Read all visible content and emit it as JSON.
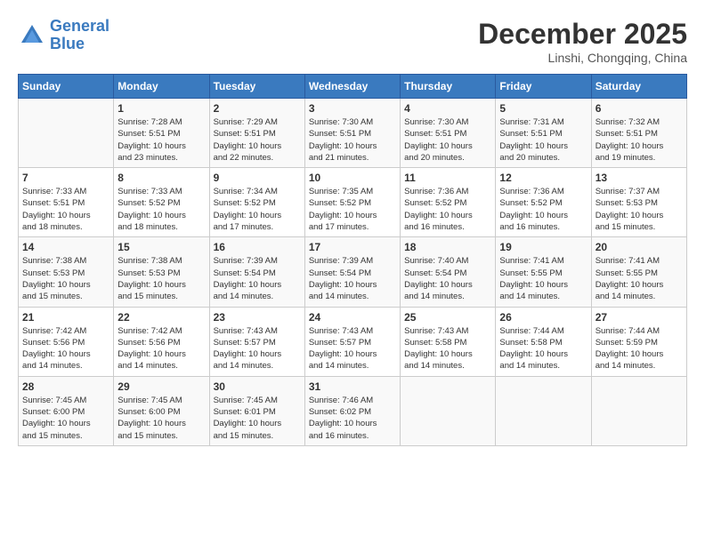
{
  "header": {
    "logo_line1": "General",
    "logo_line2": "Blue",
    "month": "December 2025",
    "location": "Linshi, Chongqing, China"
  },
  "weekdays": [
    "Sunday",
    "Monday",
    "Tuesday",
    "Wednesday",
    "Thursday",
    "Friday",
    "Saturday"
  ],
  "weeks": [
    [
      {
        "day": "",
        "info": ""
      },
      {
        "day": "1",
        "info": "Sunrise: 7:28 AM\nSunset: 5:51 PM\nDaylight: 10 hours\nand 23 minutes."
      },
      {
        "day": "2",
        "info": "Sunrise: 7:29 AM\nSunset: 5:51 PM\nDaylight: 10 hours\nand 22 minutes."
      },
      {
        "day": "3",
        "info": "Sunrise: 7:30 AM\nSunset: 5:51 PM\nDaylight: 10 hours\nand 21 minutes."
      },
      {
        "day": "4",
        "info": "Sunrise: 7:30 AM\nSunset: 5:51 PM\nDaylight: 10 hours\nand 20 minutes."
      },
      {
        "day": "5",
        "info": "Sunrise: 7:31 AM\nSunset: 5:51 PM\nDaylight: 10 hours\nand 20 minutes."
      },
      {
        "day": "6",
        "info": "Sunrise: 7:32 AM\nSunset: 5:51 PM\nDaylight: 10 hours\nand 19 minutes."
      }
    ],
    [
      {
        "day": "7",
        "info": "Sunrise: 7:33 AM\nSunset: 5:51 PM\nDaylight: 10 hours\nand 18 minutes."
      },
      {
        "day": "8",
        "info": "Sunrise: 7:33 AM\nSunset: 5:52 PM\nDaylight: 10 hours\nand 18 minutes."
      },
      {
        "day": "9",
        "info": "Sunrise: 7:34 AM\nSunset: 5:52 PM\nDaylight: 10 hours\nand 17 minutes."
      },
      {
        "day": "10",
        "info": "Sunrise: 7:35 AM\nSunset: 5:52 PM\nDaylight: 10 hours\nand 17 minutes."
      },
      {
        "day": "11",
        "info": "Sunrise: 7:36 AM\nSunset: 5:52 PM\nDaylight: 10 hours\nand 16 minutes."
      },
      {
        "day": "12",
        "info": "Sunrise: 7:36 AM\nSunset: 5:52 PM\nDaylight: 10 hours\nand 16 minutes."
      },
      {
        "day": "13",
        "info": "Sunrise: 7:37 AM\nSunset: 5:53 PM\nDaylight: 10 hours\nand 15 minutes."
      }
    ],
    [
      {
        "day": "14",
        "info": "Sunrise: 7:38 AM\nSunset: 5:53 PM\nDaylight: 10 hours\nand 15 minutes."
      },
      {
        "day": "15",
        "info": "Sunrise: 7:38 AM\nSunset: 5:53 PM\nDaylight: 10 hours\nand 15 minutes."
      },
      {
        "day": "16",
        "info": "Sunrise: 7:39 AM\nSunset: 5:54 PM\nDaylight: 10 hours\nand 14 minutes."
      },
      {
        "day": "17",
        "info": "Sunrise: 7:39 AM\nSunset: 5:54 PM\nDaylight: 10 hours\nand 14 minutes."
      },
      {
        "day": "18",
        "info": "Sunrise: 7:40 AM\nSunset: 5:54 PM\nDaylight: 10 hours\nand 14 minutes."
      },
      {
        "day": "19",
        "info": "Sunrise: 7:41 AM\nSunset: 5:55 PM\nDaylight: 10 hours\nand 14 minutes."
      },
      {
        "day": "20",
        "info": "Sunrise: 7:41 AM\nSunset: 5:55 PM\nDaylight: 10 hours\nand 14 minutes."
      }
    ],
    [
      {
        "day": "21",
        "info": "Sunrise: 7:42 AM\nSunset: 5:56 PM\nDaylight: 10 hours\nand 14 minutes."
      },
      {
        "day": "22",
        "info": "Sunrise: 7:42 AM\nSunset: 5:56 PM\nDaylight: 10 hours\nand 14 minutes."
      },
      {
        "day": "23",
        "info": "Sunrise: 7:43 AM\nSunset: 5:57 PM\nDaylight: 10 hours\nand 14 minutes."
      },
      {
        "day": "24",
        "info": "Sunrise: 7:43 AM\nSunset: 5:57 PM\nDaylight: 10 hours\nand 14 minutes."
      },
      {
        "day": "25",
        "info": "Sunrise: 7:43 AM\nSunset: 5:58 PM\nDaylight: 10 hours\nand 14 minutes."
      },
      {
        "day": "26",
        "info": "Sunrise: 7:44 AM\nSunset: 5:58 PM\nDaylight: 10 hours\nand 14 minutes."
      },
      {
        "day": "27",
        "info": "Sunrise: 7:44 AM\nSunset: 5:59 PM\nDaylight: 10 hours\nand 14 minutes."
      }
    ],
    [
      {
        "day": "28",
        "info": "Sunrise: 7:45 AM\nSunset: 6:00 PM\nDaylight: 10 hours\nand 15 minutes."
      },
      {
        "day": "29",
        "info": "Sunrise: 7:45 AM\nSunset: 6:00 PM\nDaylight: 10 hours\nand 15 minutes."
      },
      {
        "day": "30",
        "info": "Sunrise: 7:45 AM\nSunset: 6:01 PM\nDaylight: 10 hours\nand 15 minutes."
      },
      {
        "day": "31",
        "info": "Sunrise: 7:46 AM\nSunset: 6:02 PM\nDaylight: 10 hours\nand 16 minutes."
      },
      {
        "day": "",
        "info": ""
      },
      {
        "day": "",
        "info": ""
      },
      {
        "day": "",
        "info": ""
      }
    ]
  ]
}
